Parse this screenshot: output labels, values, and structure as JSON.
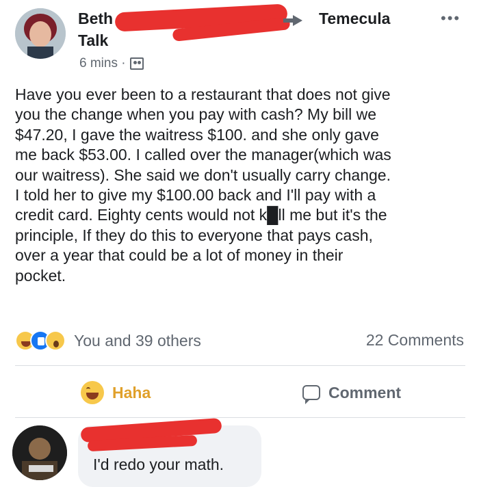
{
  "post": {
    "author_first": "Beth",
    "author_last": "Talk",
    "group": "Temecula",
    "more": "•••",
    "time": "6 mins ·",
    "text_lines": [
      "Have you ever been to a restaurant that does not give",
      "you the change when you pay with cash? My bill we",
      "$47.20, I gave the waitress $100. and she only gave",
      "me back $53.00. I called over the manager(which was",
      "our waitress). She said we don't usually carry change.",
      "I told her to give my $100.00 back and I'll pay with a",
      "credit card. Eighty cents would not k█ll me but it's the",
      "principle, If they do this to everyone that pays cash,",
      "over a year that could be a lot of money in their",
      "pocket."
    ]
  },
  "reactions": {
    "icons": [
      "haha-icon",
      "like-icon",
      "wow-icon"
    ],
    "summary": "You and 39 others",
    "comments": "22 Comments"
  },
  "actions": {
    "haha": "Haha",
    "comment": "Comment"
  },
  "comment": {
    "text": "I'd redo your math."
  },
  "colors": {
    "redaction": "#e8312f",
    "haha": "#e0a02a",
    "muted": "#606770",
    "bubble": "#f0f2f5"
  }
}
